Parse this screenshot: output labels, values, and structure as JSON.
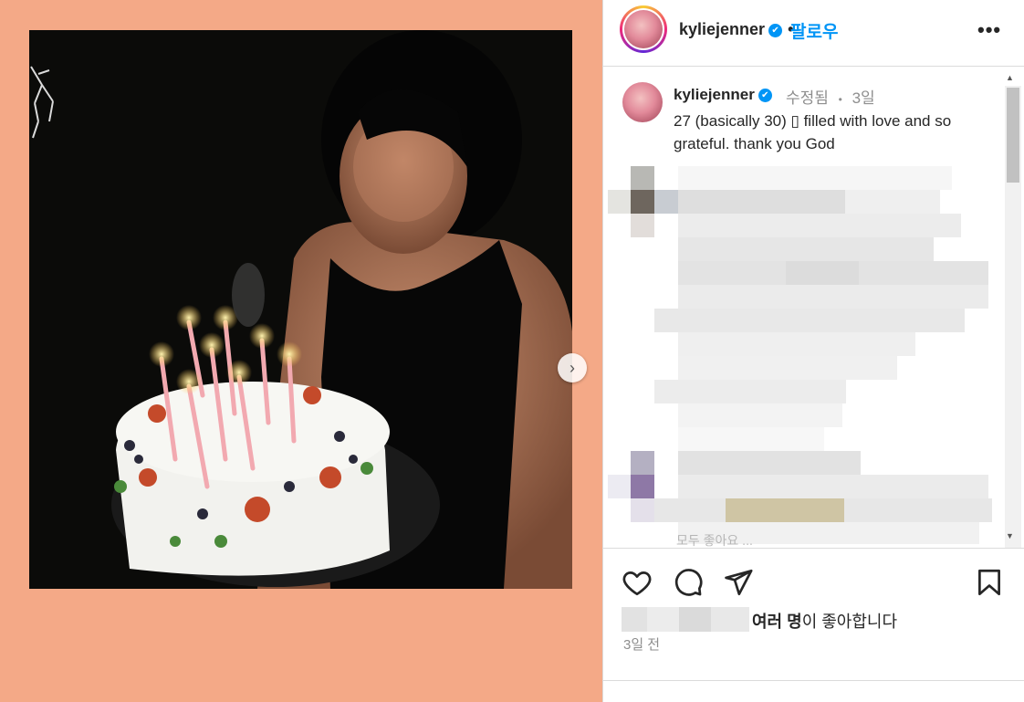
{
  "header": {
    "username": "kyliejenner",
    "verified_mark": "✔",
    "follow_label": "팔로우",
    "more_icon": "•••"
  },
  "caption": {
    "username": "kyliejenner",
    "edited_label": "수정됨",
    "separator": "•",
    "age": "3일",
    "text": "27 (basically 30) ▯ filled with love and so grateful. thank you God"
  },
  "comments_blur_text": "모두 좋아요 ...",
  "actions": {
    "like_icon": "heart-icon",
    "comment_icon": "comment-icon",
    "share_icon": "paper-plane-icon",
    "save_icon": "bookmark-icon"
  },
  "likes": {
    "bold": "여러 명",
    "rest": "이 좋아합니다"
  },
  "timestamp": "3일 전",
  "media": {
    "next_icon": "›"
  }
}
